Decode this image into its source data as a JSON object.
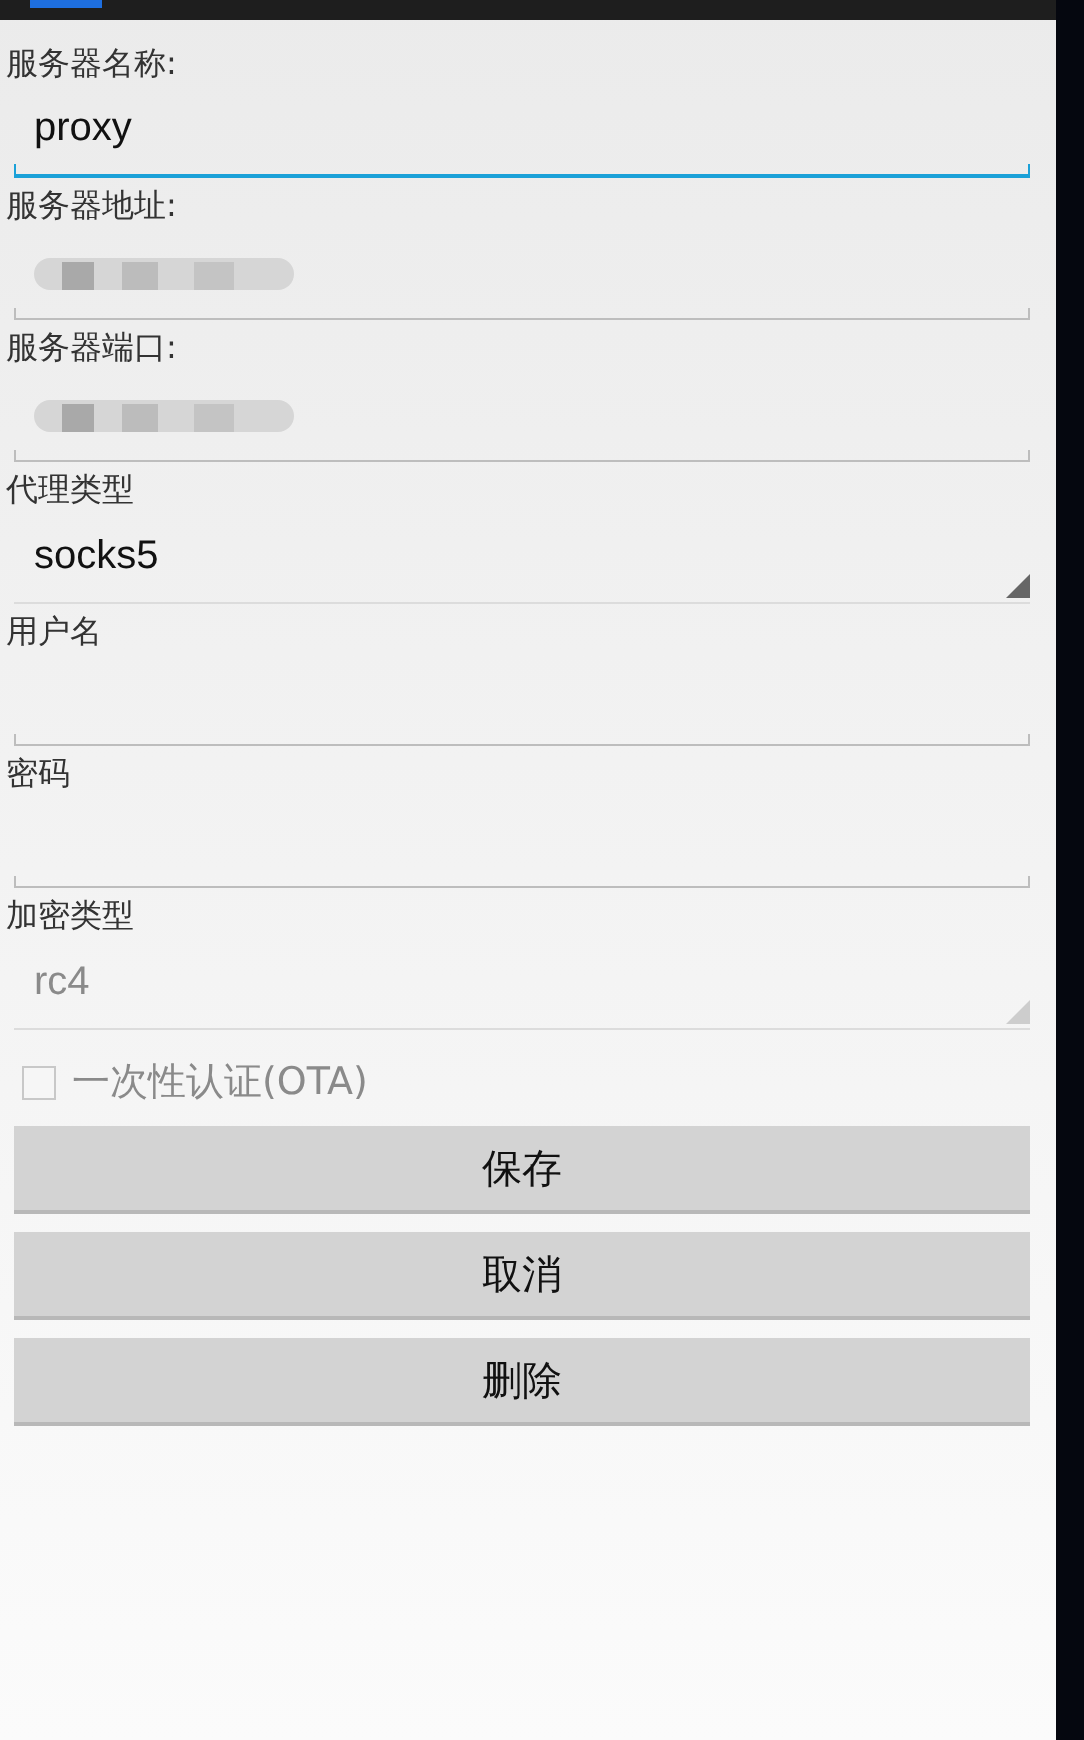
{
  "form": {
    "fields": [
      {
        "kind": "text",
        "label": "服务器名称:",
        "value": "proxy",
        "focused": true,
        "redacted": false
      },
      {
        "kind": "text",
        "label": "服务器地址:",
        "focused": false,
        "redacted": true
      },
      {
        "kind": "text",
        "label": "服务器端口:",
        "focused": false,
        "redacted": true
      },
      {
        "kind": "spinner",
        "label": "代理类型",
        "value": "socks5",
        "disabled": false
      },
      {
        "kind": "text",
        "label": "用户名",
        "focused": false,
        "redacted": false
      },
      {
        "kind": "text",
        "label": "密码",
        "focused": false,
        "redacted": false
      },
      {
        "kind": "spinner",
        "label": "加密类型",
        "value": "rc4",
        "disabled": true
      }
    ],
    "checkbox": {
      "label": "一次性认证(OTA)",
      "checked": false,
      "disabled": true
    },
    "buttons": [
      "保存",
      "取消",
      "删除"
    ]
  }
}
